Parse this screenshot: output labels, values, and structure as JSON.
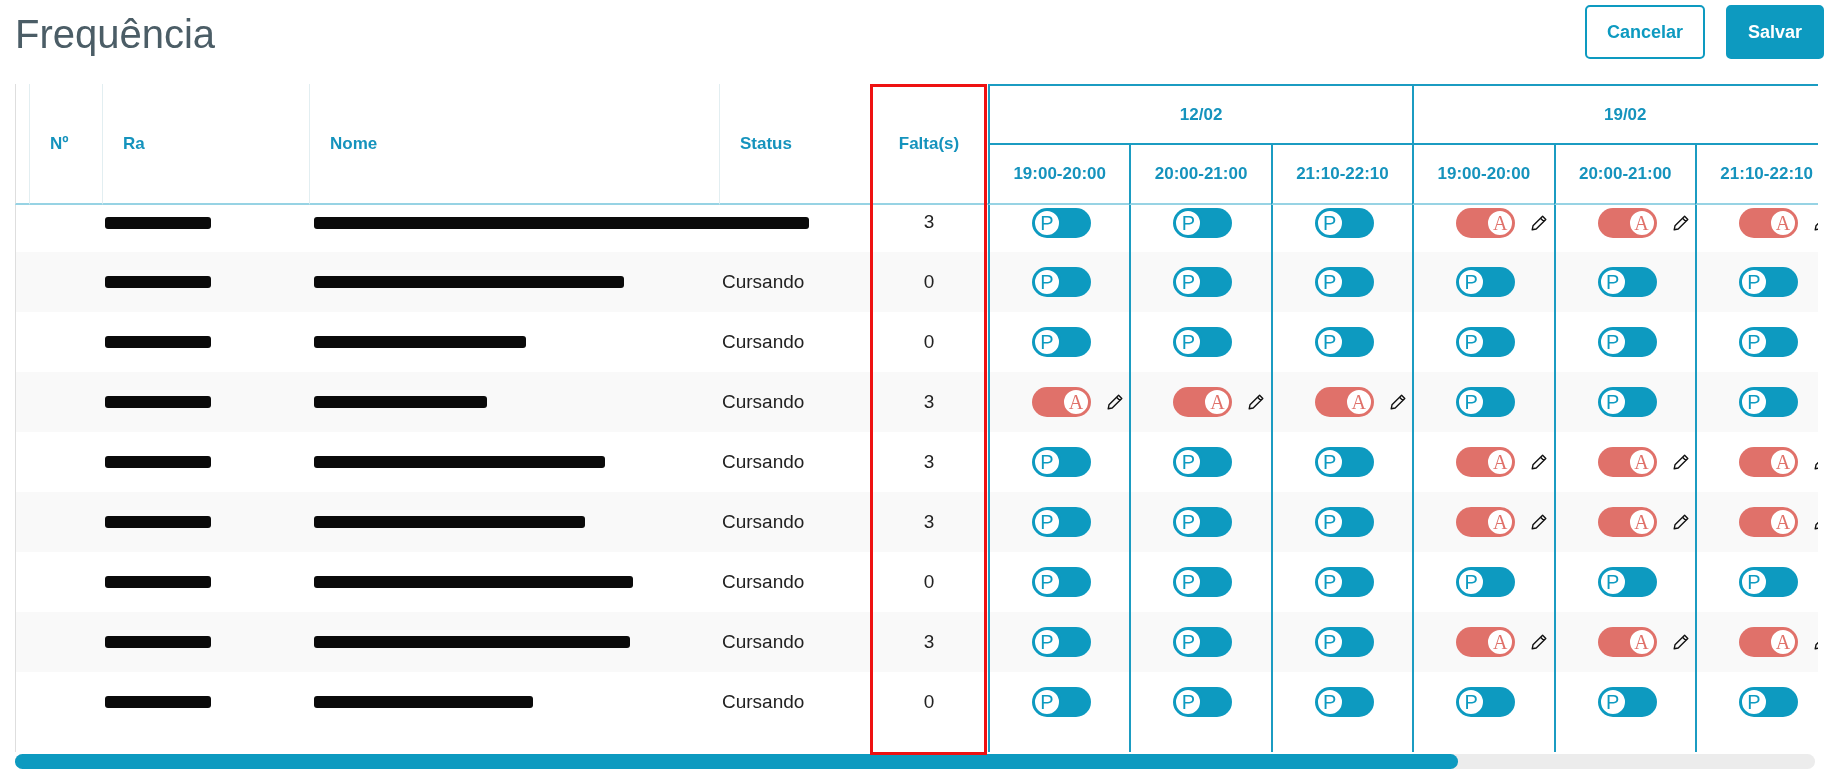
{
  "title": "Frequência",
  "buttons": [
    {
      "label": "Cancelar",
      "kind": "outline"
    },
    {
      "label": "Salvar",
      "kind": "primary"
    }
  ],
  "table": {
    "columns": [
      {
        "label": "Nº",
        "highlighted": false
      },
      {
        "label": "Ra",
        "highlighted": false
      },
      {
        "label": "Nome",
        "highlighted": false
      },
      {
        "label": "Status",
        "highlighted": false
      },
      {
        "label": "Falta(s)",
        "highlighted": true
      }
    ],
    "dates": [
      {
        "label": "12/02",
        "slots": [
          "19:00-20:00",
          "20:00-21:00",
          "21:10-22:10"
        ]
      },
      {
        "label": "19/02",
        "slots": [
          "19:00-20:00",
          "20:00-21:00",
          "21:10-22:10"
        ]
      }
    ],
    "rows": [
      {
        "ra_redacted": true,
        "name_redacted": true,
        "absences": "3",
        "attendance": [
          {
            "label": "P",
            "absent": false
          },
          {
            "label": "P",
            "absent": false
          },
          {
            "label": "P",
            "absent": false
          },
          {
            "label": "A",
            "absent": true
          },
          {
            "label": "A",
            "absent": true
          },
          {
            "label": "A",
            "absent": true
          }
        ]
      },
      {
        "ra_redacted": true,
        "name_redacted": true,
        "status": "Cursando",
        "absences": "0",
        "attendance": [
          {
            "label": "P",
            "absent": false
          },
          {
            "label": "P",
            "absent": false
          },
          {
            "label": "P",
            "absent": false
          },
          {
            "label": "P",
            "absent": false
          },
          {
            "label": "P",
            "absent": false
          },
          {
            "label": "P",
            "absent": false
          }
        ]
      },
      {
        "ra_redacted": true,
        "name_redacted": true,
        "status": "Cursando",
        "absences": "0",
        "attendance": [
          {
            "label": "P",
            "absent": false
          },
          {
            "label": "P",
            "absent": false
          },
          {
            "label": "P",
            "absent": false
          },
          {
            "label": "P",
            "absent": false
          },
          {
            "label": "P",
            "absent": false
          },
          {
            "label": "P",
            "absent": false
          }
        ]
      },
      {
        "ra_redacted": true,
        "name_redacted": true,
        "status": "Cursando",
        "absences": "3",
        "attendance": [
          {
            "label": "A",
            "absent": true
          },
          {
            "label": "A",
            "absent": true
          },
          {
            "label": "A",
            "absent": true
          },
          {
            "label": "P",
            "absent": false
          },
          {
            "label": "P",
            "absent": false
          },
          {
            "label": "P",
            "absent": false
          }
        ]
      },
      {
        "ra_redacted": true,
        "name_redacted": true,
        "status": "Cursando",
        "absences": "3",
        "attendance": [
          {
            "label": "P",
            "absent": false
          },
          {
            "label": "P",
            "absent": false
          },
          {
            "label": "P",
            "absent": false
          },
          {
            "label": "A",
            "absent": true
          },
          {
            "label": "A",
            "absent": true
          },
          {
            "label": "A",
            "absent": true
          }
        ]
      },
      {
        "ra_redacted": true,
        "name_redacted": true,
        "status": "Cursando",
        "absences": "3",
        "attendance": [
          {
            "label": "P",
            "absent": false
          },
          {
            "label": "P",
            "absent": false
          },
          {
            "label": "P",
            "absent": false
          },
          {
            "label": "A",
            "absent": true
          },
          {
            "label": "A",
            "absent": true
          },
          {
            "label": "A",
            "absent": true
          }
        ]
      },
      {
        "ra_redacted": true,
        "name_redacted": true,
        "status": "Cursando",
        "absences": "0",
        "attendance": [
          {
            "label": "P",
            "absent": false
          },
          {
            "label": "P",
            "absent": false
          },
          {
            "label": "P",
            "absent": false
          },
          {
            "label": "P",
            "absent": false
          },
          {
            "label": "P",
            "absent": false
          },
          {
            "label": "P",
            "absent": false
          }
        ]
      },
      {
        "ra_redacted": true,
        "name_redacted": true,
        "status": "Cursando",
        "absences": "3",
        "attendance": [
          {
            "label": "P",
            "absent": false
          },
          {
            "label": "P",
            "absent": false
          },
          {
            "label": "P",
            "absent": false
          },
          {
            "label": "A",
            "absent": true
          },
          {
            "label": "A",
            "absent": true
          },
          {
            "label": "A",
            "absent": true
          }
        ]
      },
      {
        "ra_redacted": true,
        "name_redacted": true,
        "status": "Cursando",
        "absences": "0",
        "attendance": [
          {
            "label": "P",
            "absent": false
          },
          {
            "label": "P",
            "absent": false
          },
          {
            "label": "P",
            "absent": false
          },
          {
            "label": "P",
            "absent": false
          },
          {
            "label": "P",
            "absent": false
          },
          {
            "label": "P",
            "absent": false
          }
        ]
      }
    ]
  }
}
